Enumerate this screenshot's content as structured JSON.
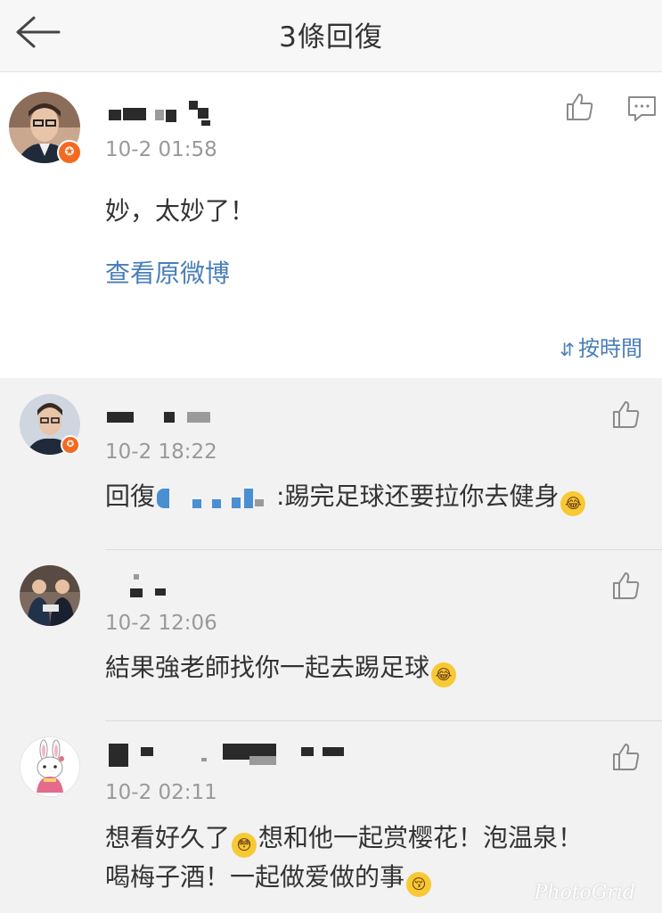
{
  "header": {
    "title": "3條回復"
  },
  "main_post": {
    "time": "10-2 01:58",
    "content": "妙，太妙了！",
    "view_original": "查看原微博",
    "sort_label": "按時間",
    "sort_icon": "sort-lines-icon"
  },
  "replies": [
    {
      "time": "10-2 18:22",
      "reply_prefix": "回復",
      "content": ":踢完足球还要拉你去健身"
    },
    {
      "time": "10-2 12:06",
      "content": "結果強老師找你一起去踢足球"
    },
    {
      "time": "10-2 02:11",
      "content_line1_a": "想看好久了",
      "content_line1_b": "想和他一起赏樱花！泡温泉！",
      "content_line2": "喝梅子酒！一起做爱做的事"
    }
  ],
  "watermark": "PhotoGrid",
  "colors": {
    "link": "#4a7eb8",
    "badge": "#f36a21",
    "time": "#999999"
  }
}
